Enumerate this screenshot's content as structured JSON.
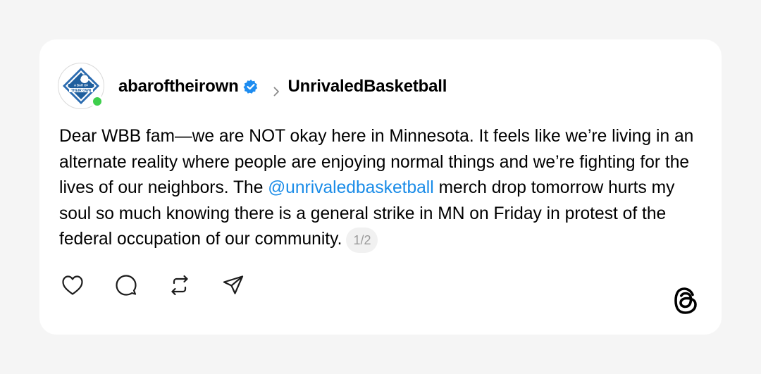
{
  "post": {
    "author": "abaroftheirown",
    "community": "UnrivaledBasketball",
    "text_before": "Dear WBB fam—we are NOT okay here in Minnesota. It feels like we’re living in an alternate reality where people are enjoying normal things and we’re fighting for the lives of our neighbors. The ",
    "mention": "@unrivaledbasketball",
    "text_after": " merch drop tomorrow hurts my soul so much knowing there is a general strike in MN on Friday in protest of the federal occupation of our community.",
    "counter": "1/2"
  },
  "avatar": {
    "logo_line1": "A BAR OF",
    "logo_line2": "THEIR OWN",
    "online": true
  },
  "icons": {
    "verified": "verified-badge-icon",
    "chevron": "chevron-right-icon",
    "like": "heart-icon",
    "reply": "comment-icon",
    "repost": "repost-icon",
    "share": "send-icon",
    "brand": "threads-logo-icon"
  },
  "colors": {
    "mention": "#1a8ce8",
    "verified": "#1d8cf0",
    "online": "#3ecf4c",
    "background": "#f5f5f5"
  }
}
